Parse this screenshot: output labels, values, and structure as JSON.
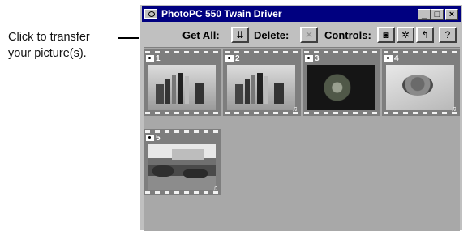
{
  "callout": {
    "line1": "Click to transfer",
    "line2": "your picture(s)."
  },
  "window": {
    "title": "PhotoPC 550 Twain Driver",
    "controls": {
      "minimize": "_",
      "maximize": "□",
      "close": "×"
    }
  },
  "toolbar": {
    "get_all_label": "Get All:",
    "delete_label": "Delete:",
    "controls_label": "Controls:",
    "help_label": "?"
  },
  "thumbnails": [
    {
      "number": "1",
      "subject": "books and bookends"
    },
    {
      "number": "2",
      "subject": "books and bookends"
    },
    {
      "number": "3",
      "subject": "flowers on dark background"
    },
    {
      "number": "4",
      "subject": "bowl of fruit"
    },
    {
      "number": "5",
      "subject": "garden with rocks and building"
    }
  ]
}
